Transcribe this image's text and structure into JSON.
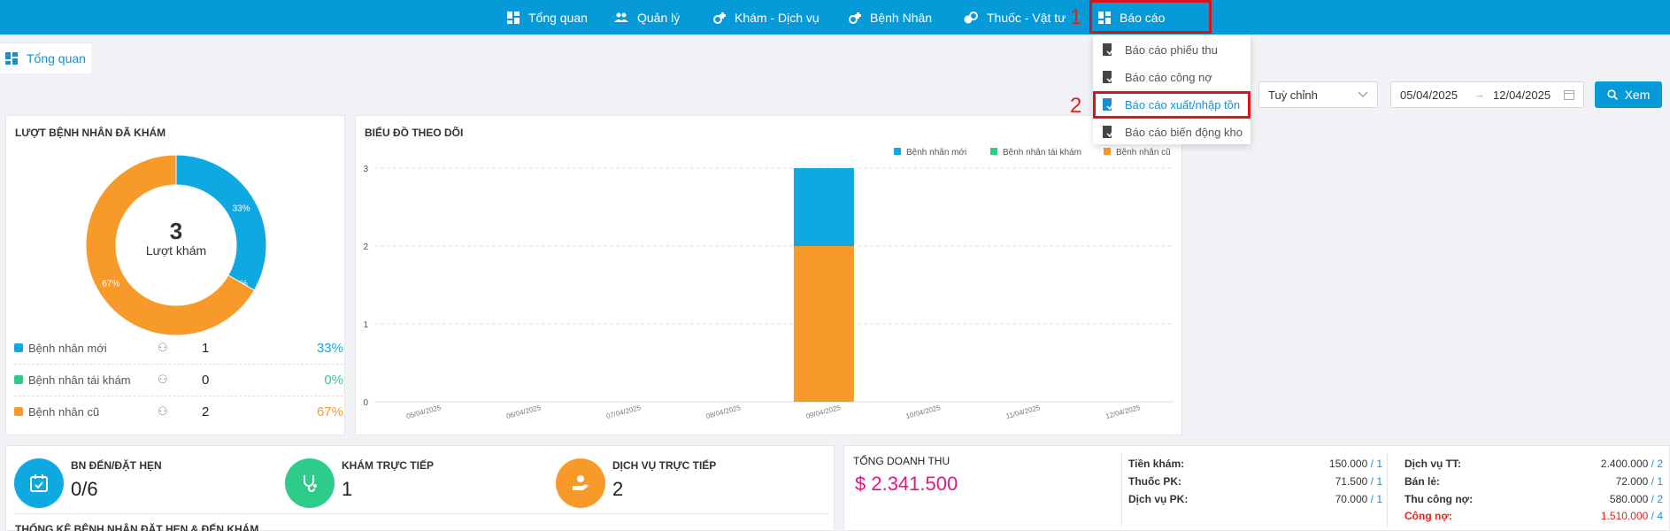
{
  "nav": {
    "items": [
      {
        "label": "Tổng quan",
        "icon": "dashboard-icon"
      },
      {
        "label": "Quản lý",
        "icon": "users-icon"
      },
      {
        "label": "Khám - Dịch vụ",
        "icon": "medical-service-icon"
      },
      {
        "label": "Bệnh Nhân",
        "icon": "patient-icon"
      },
      {
        "label": "Thuốc - Vật tư",
        "icon": "medicine-icon"
      },
      {
        "label": "Báo cáo",
        "icon": "report-icon"
      }
    ],
    "annotation_1": "1",
    "annotation_2": "2"
  },
  "report_menu": {
    "items": [
      {
        "label": "Báo cáo phiếu thu"
      },
      {
        "label": "Báo cáo công nợ"
      },
      {
        "label": "Báo cáo xuất/nhập tồn"
      },
      {
        "label": "Báo cáo biến động kho"
      }
    ],
    "active_index": 2
  },
  "tabs": [
    {
      "label": "Tổng quan"
    }
  ],
  "filters": {
    "range_select": "Tuỳ chỉnh",
    "date_from": "05/04/2025",
    "date_separator": "→",
    "date_to": "12/04/2025",
    "view_button": "Xem"
  },
  "colors": {
    "primary": "#079ad9",
    "new": "#0fa9e1",
    "revisit": "#2ecc8a",
    "old": "#f89a2a",
    "revenue": "#e6157e",
    "debt": "#e0241b"
  },
  "patients_card": {
    "title": "LƯỢT BỆNH NHÂN ĐÃ KHÁM",
    "total": "3",
    "total_label": "Lượt khám",
    "rows": [
      {
        "label": "Bệnh nhân mới",
        "count": "1",
        "percent": "33%",
        "color": "#0fa9e1"
      },
      {
        "label": "Bệnh nhân tái khám",
        "count": "0",
        "percent": "0%",
        "color": "#2ecc8a"
      },
      {
        "label": "Bệnh nhân cũ",
        "count": "2",
        "percent": "67%",
        "color": "#f89a2a"
      }
    ]
  },
  "chart_data": [
    {
      "type": "pie",
      "title": "",
      "categories": [
        "Bệnh nhân mới",
        "Bệnh nhân tái khám",
        "Bệnh nhân cũ"
      ],
      "values": [
        1,
        0,
        2
      ],
      "labels": [
        "33%",
        "0%",
        "67%"
      ],
      "colors": [
        "#0fa9e1",
        "#2ecc8a",
        "#f89a2a"
      ]
    },
    {
      "type": "bar",
      "title": "BIỂU ĐỒ THEO DÕI",
      "stacked": true,
      "categories": [
        "05/04/2025",
        "06/04/2025",
        "07/04/2025",
        "08/04/2025",
        "09/04/2025",
        "10/04/2025",
        "11/04/2025",
        "12/04/2025"
      ],
      "series": [
        {
          "name": "Bệnh nhân mới",
          "color": "#0fa9e1",
          "values": [
            0,
            0,
            0,
            0,
            1,
            0,
            0,
            0
          ]
        },
        {
          "name": "Bệnh nhân tái khám",
          "color": "#2ecc8a",
          "values": [
            0,
            0,
            0,
            0,
            0,
            0,
            0,
            0
          ]
        },
        {
          "name": "Bệnh nhân cũ",
          "color": "#f89a2a",
          "values": [
            0,
            0,
            0,
            0,
            2,
            0,
            0,
            0
          ]
        }
      ],
      "yticks": [
        "0",
        "1",
        "2",
        "3"
      ],
      "ylim": [
        0,
        3
      ],
      "grid": true,
      "legend_position": "top-right"
    }
  ],
  "stats": [
    {
      "label": "BN ĐẾN/ĐẶT HẸN",
      "value": "0/6",
      "color": "#0fa9e1",
      "icon": "calendar-check-icon"
    },
    {
      "label": "KHÁM TRỰC TIẾP",
      "value": "1",
      "color": "#2ecc8a",
      "icon": "stethoscope-icon"
    },
    {
      "label": "DỊCH VỤ TRỰC TIẾP",
      "value": "2",
      "color": "#f89a2a",
      "icon": "hand-service-icon"
    }
  ],
  "stats_footer": "THỐNG KÊ BỆNH NHÂN ĐẶT HẸN & ĐẾN KHÁM",
  "revenue": {
    "title": "TỔNG DOANH THU",
    "total": "$ 2.341.500",
    "col1": [
      {
        "label": "Tiền khám:",
        "value": "150.000",
        "sep": " / ",
        "count": "1"
      },
      {
        "label": "Thuốc PK:",
        "value": "71.500",
        "sep": " / ",
        "count": "1"
      },
      {
        "label": "Dịch vụ PK:",
        "value": "70.000",
        "sep": " / ",
        "count": "1"
      }
    ],
    "col2": [
      {
        "label": "Dịch vụ TT:",
        "value": "2.400.000",
        "sep": " / ",
        "count": "2"
      },
      {
        "label": "Bán lẻ:",
        "value": "72.000",
        "sep": " / ",
        "count": "1"
      },
      {
        "label": "Thu công nợ:",
        "value": "580.000",
        "sep": " / ",
        "count": "2"
      },
      {
        "label": "Công nợ:",
        "value": "1.510.000",
        "sep": " / ",
        "count": "4"
      }
    ]
  }
}
